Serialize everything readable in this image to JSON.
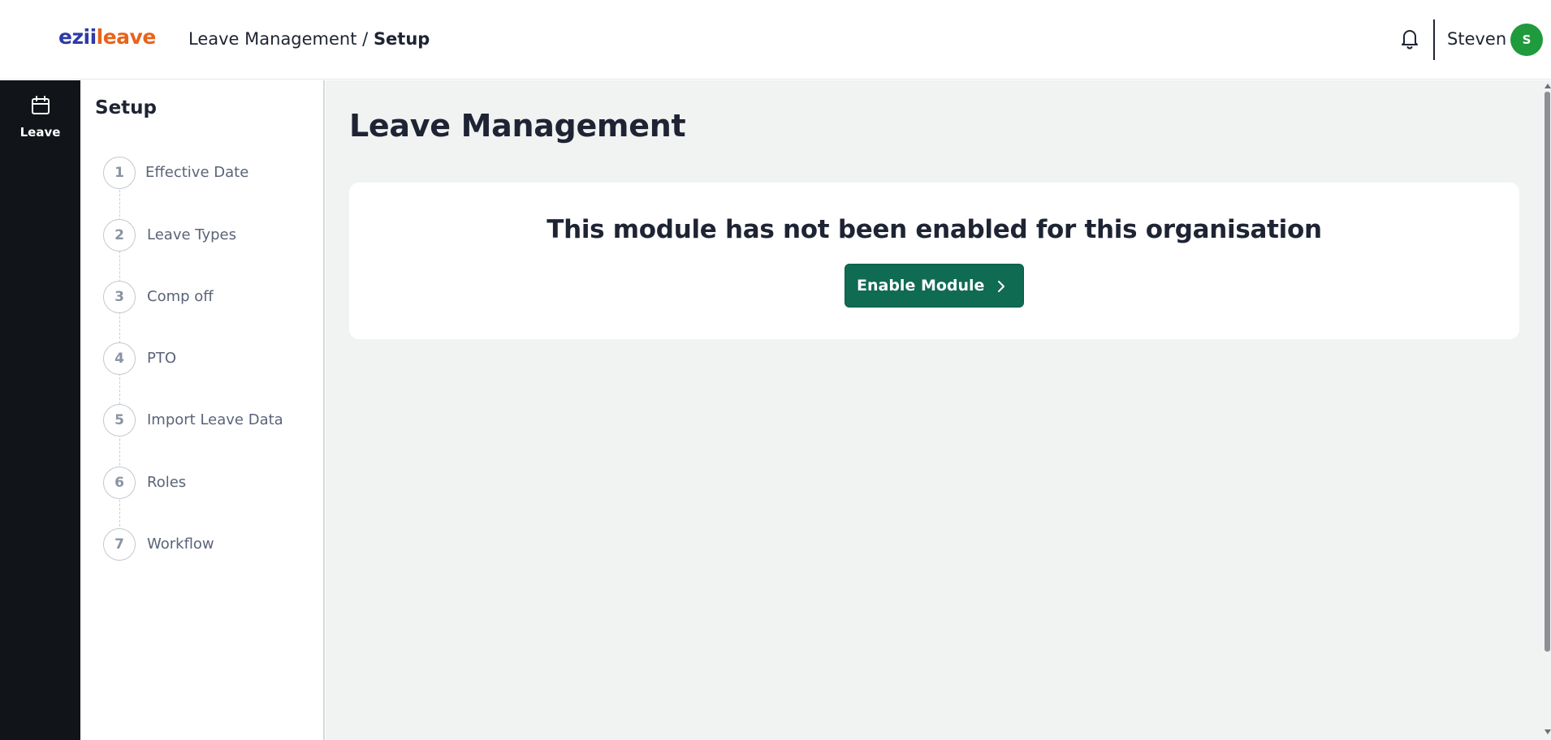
{
  "header": {
    "logo": {
      "part1": "ezii",
      "part2": "leave"
    },
    "breadcrumb": {
      "parent": "Leave Management",
      "separator": "/",
      "current": "Setup"
    },
    "notifications_icon": "bell-icon",
    "user": {
      "name": "Steven",
      "avatar_initial": "S",
      "avatar_color": "#1f9a3c"
    }
  },
  "rail": {
    "items": [
      {
        "label": "Leave",
        "icon": "calendar-icon"
      }
    ]
  },
  "setup": {
    "title": "Setup",
    "steps": [
      {
        "number": "1",
        "label": "Effective Date"
      },
      {
        "number": "2",
        "label": "Leave Types"
      },
      {
        "number": "3",
        "label": "Comp off"
      },
      {
        "number": "4",
        "label": "PTO"
      },
      {
        "number": "5",
        "label": "Import Leave Data"
      },
      {
        "number": "6",
        "label": "Roles"
      },
      {
        "number": "7",
        "label": "Workflow"
      }
    ]
  },
  "main": {
    "title": "Leave Management",
    "message": "This module has not been enabled for this organisation",
    "enable_button_label": "Enable Module",
    "enable_button_icon": "chevron-right-icon"
  },
  "colors": {
    "brand_blue": "#2d3aa8",
    "brand_orange": "#e8631c",
    "primary_button": "#0f6b52",
    "rail_background": "#111418",
    "content_background": "#f1f2f2"
  }
}
